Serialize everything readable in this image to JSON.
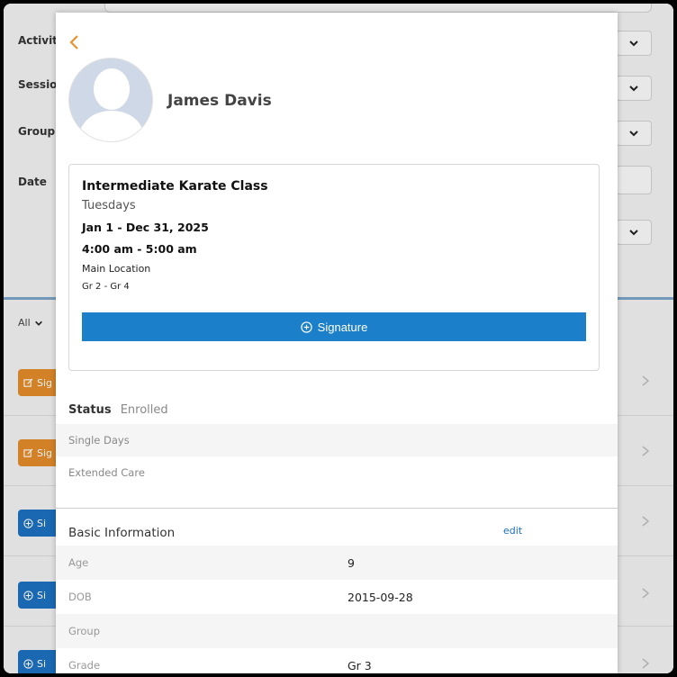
{
  "background": {
    "labels": [
      "Activity",
      "Session",
      "Group",
      "Date"
    ],
    "filter_label": "All",
    "row_buttons": [
      {
        "label": "Sig",
        "color": "orange",
        "icon": "edit-icon"
      },
      {
        "label": "Sig",
        "color": "orange",
        "icon": "edit-icon"
      },
      {
        "label": "Si",
        "color": "blue",
        "icon": "plus-circle-icon"
      },
      {
        "label": "Si",
        "color": "blue",
        "icon": "plus-circle-icon"
      },
      {
        "label": "Si",
        "color": "blue",
        "icon": "plus-circle-icon"
      }
    ]
  },
  "modal": {
    "back_icon": "chevron-left-icon",
    "person_name": "James Davis",
    "class_card": {
      "title": "Intermediate Karate Class",
      "days": "Tuesdays",
      "dates": "Jan 1 - Dec 31, 2025",
      "time": "4:00 am - 5:00 am",
      "location": "Main Location",
      "grades": "Gr 2 - Gr 4",
      "signature_button": "Signature"
    },
    "status": {
      "label": "Status",
      "value": "Enrolled"
    },
    "options": [
      "Single Days",
      "Extended Care"
    ],
    "basic_info": {
      "title": "Basic Information",
      "edit_label": "edit",
      "rows": [
        {
          "label": "Age",
          "value": "9"
        },
        {
          "label": "DOB",
          "value": "2015-09-28"
        },
        {
          "label": "Group",
          "value": ""
        },
        {
          "label": "Grade",
          "value": "Gr 3"
        }
      ]
    }
  },
  "colors": {
    "accent_orange": "#e08a2a",
    "accent_blue": "#1c7fc9",
    "link_blue": "#1c6fbd"
  }
}
